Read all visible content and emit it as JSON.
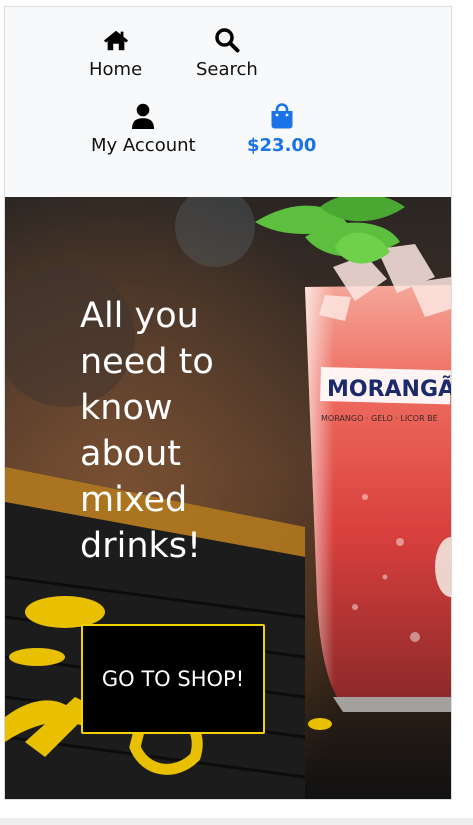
{
  "nav": {
    "items": [
      {
        "label": "Home",
        "icon": "home-icon"
      },
      {
        "label": "Search",
        "icon": "search-icon"
      },
      {
        "label": "My Account",
        "icon": "user-icon"
      },
      {
        "label": "$23.00",
        "icon": "shopping-bag-icon"
      }
    ]
  },
  "hero": {
    "heading": "All you need to know about mixed drinks!",
    "cta_label": "GO TO SHOP!",
    "glass_brand": "MORANGÃO",
    "glass_ingredients": "MORANGO · GELO · LICOR BE"
  },
  "colors": {
    "accent": "#1a73e8",
    "cta_border": "#f2d100",
    "nav_background": "#f8f9fa"
  }
}
